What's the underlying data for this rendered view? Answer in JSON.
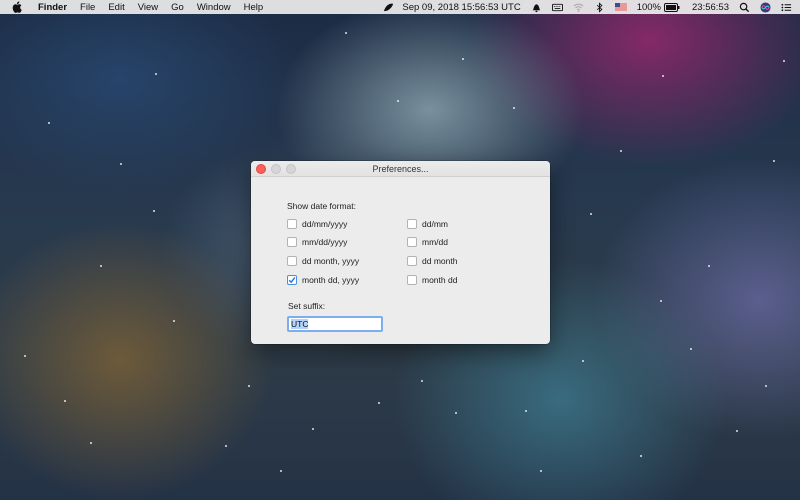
{
  "menubar": {
    "app_name": "Finder",
    "menus": [
      "File",
      "Edit",
      "View",
      "Go",
      "Window",
      "Help"
    ],
    "status_date": "Sep 09, 2018 15:56:53 UTC",
    "battery": "100%",
    "clock": "23:56:53",
    "icons": [
      "apple-icon",
      "leaf-icon",
      "bell-icon",
      "keyboard-icon",
      "wifi-icon",
      "bluetooth-icon",
      "us-flag-icon",
      "battery-icon",
      "search-icon",
      "siri-icon",
      "list-icon"
    ]
  },
  "window": {
    "title": "Preferences...",
    "date_format_label": "Show date format:",
    "formats": [
      {
        "label": "dd/mm/yyyy",
        "checked": false
      },
      {
        "label": "dd/mm",
        "checked": false
      },
      {
        "label": "mm/dd/yyyy",
        "checked": false
      },
      {
        "label": "mm/dd",
        "checked": false
      },
      {
        "label": "dd month, yyyy",
        "checked": false
      },
      {
        "label": "dd month",
        "checked": false
      },
      {
        "label": "month dd, yyyy",
        "checked": true
      },
      {
        "label": "month dd",
        "checked": false
      }
    ],
    "suffix_label": "Set suffix:",
    "suffix_value": "UTC"
  },
  "colors": {
    "close_button": "#fc5f57",
    "focus_ring": "#7aaef0",
    "checkmark": "#2a6fd6"
  }
}
